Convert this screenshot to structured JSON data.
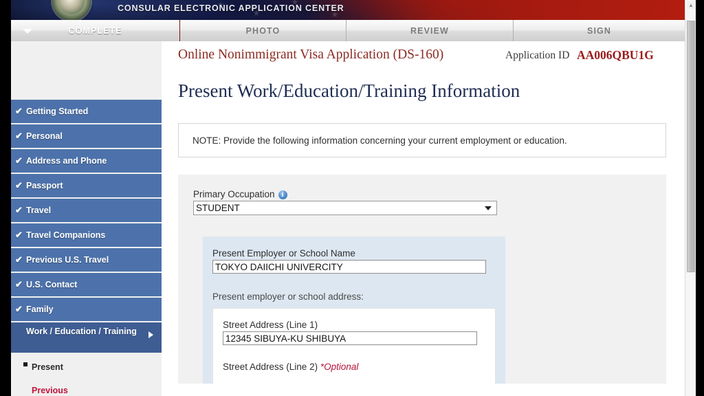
{
  "banner": {
    "title": "CONSULAR ELECTRONIC APPLICATION CENTER",
    "seal_icon": "us-state-department-seal-icon"
  },
  "tabs": [
    {
      "label": "COMPLETE",
      "active": true,
      "caret_icon": "caret-down-icon"
    },
    {
      "label": "PHOTO",
      "active": false
    },
    {
      "label": "REVIEW",
      "active": false
    },
    {
      "label": "SIGN",
      "active": false
    }
  ],
  "app_header": {
    "form_title": "Online Nonimmigrant Visa Application (DS-160)",
    "application_id_label": "Application ID",
    "application_id_value": "AA006QBU1G"
  },
  "page": {
    "title": "Present Work/Education/Training Information",
    "note": "NOTE: Provide the following information concerning your current employment or education."
  },
  "sidebar": {
    "items": [
      {
        "label": "Getting Started",
        "check": "✔"
      },
      {
        "label": "Personal",
        "check": "✔"
      },
      {
        "label": "Address and Phone",
        "check": "✔"
      },
      {
        "label": "Passport",
        "check": "✔"
      },
      {
        "label": "Travel",
        "check": "✔"
      },
      {
        "label": "Travel Companions",
        "check": "✔"
      },
      {
        "label": "Previous U.S. Travel",
        "check": "✔"
      },
      {
        "label": "U.S. Contact",
        "check": "✔"
      },
      {
        "label": "Family",
        "check": "✔"
      }
    ],
    "current_item": {
      "label": "Work / Education / Training",
      "arrow_icon": "caret-right-icon"
    },
    "subitems": [
      {
        "label": "Present",
        "state": "active",
        "bullet_icon": "square-bullet-icon"
      },
      {
        "label": "Previous",
        "state": "link"
      }
    ]
  },
  "form": {
    "primary_occupation": {
      "label": "Primary Occupation",
      "info_icon": "info-circle-icon",
      "info_glyph": "i",
      "value": "STUDENT",
      "options": [
        "STUDENT"
      ],
      "caret_icon": "caret-down-icon"
    },
    "employer_name": {
      "label": "Present Employer or School Name",
      "value": "TOKYO DAIICHI UNIVERCITY",
      "placeholder": ""
    },
    "address_heading": "Present employer or school address:",
    "street_line1": {
      "label": "Street Address (Line 1)",
      "value": "12345 SIBUYA-KU SHIBUYA",
      "placeholder": ""
    },
    "street_line2": {
      "label": "Street Address (Line 2)",
      "optional_tag": "*Optional"
    }
  },
  "scrollbar": {
    "up_arrow_icon": "caret-up-icon",
    "up_arrow_glyph": "▲"
  },
  "colors": {
    "brand_red": "#bb1a10",
    "nav_blue": "#4d72ab",
    "nav_blue_active": "#3e5d93",
    "title_navy": "#1f2d53",
    "link_red": "#c0143c",
    "app_id_red": "#9b1b1b"
  }
}
